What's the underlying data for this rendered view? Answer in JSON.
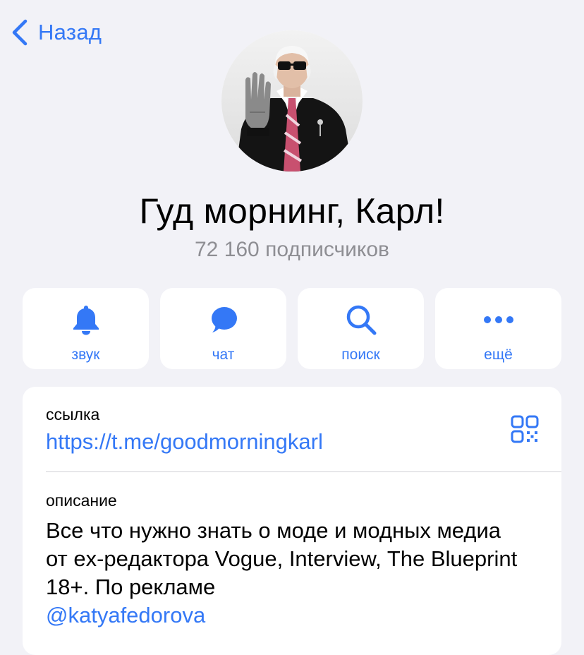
{
  "nav": {
    "back_label": "Назад"
  },
  "channel": {
    "title": "Гуд морнинг, Карл!",
    "subscribers": "72 160 подписчиков"
  },
  "actions": [
    {
      "label": "звук",
      "icon": "bell-icon"
    },
    {
      "label": "чат",
      "icon": "chat-bubble-icon"
    },
    {
      "label": "поиск",
      "icon": "search-icon"
    },
    {
      "label": "ещё",
      "icon": "more-icon"
    }
  ],
  "info": {
    "link_label": "ссылка",
    "link_value": "https://t.me/goodmorningkarl",
    "qr_icon": "qr-code-icon",
    "description_label": "описание",
    "description_text": "Все что нужно знать о моде и модных медиа от ex-редактора Vogue, Interview, The Blueprint 18+. По рекламе",
    "description_mention": "@katyafedorova"
  },
  "colors": {
    "accent": "#3478f6",
    "background": "#f2f2f7",
    "secondary_text": "#8e8e93"
  }
}
